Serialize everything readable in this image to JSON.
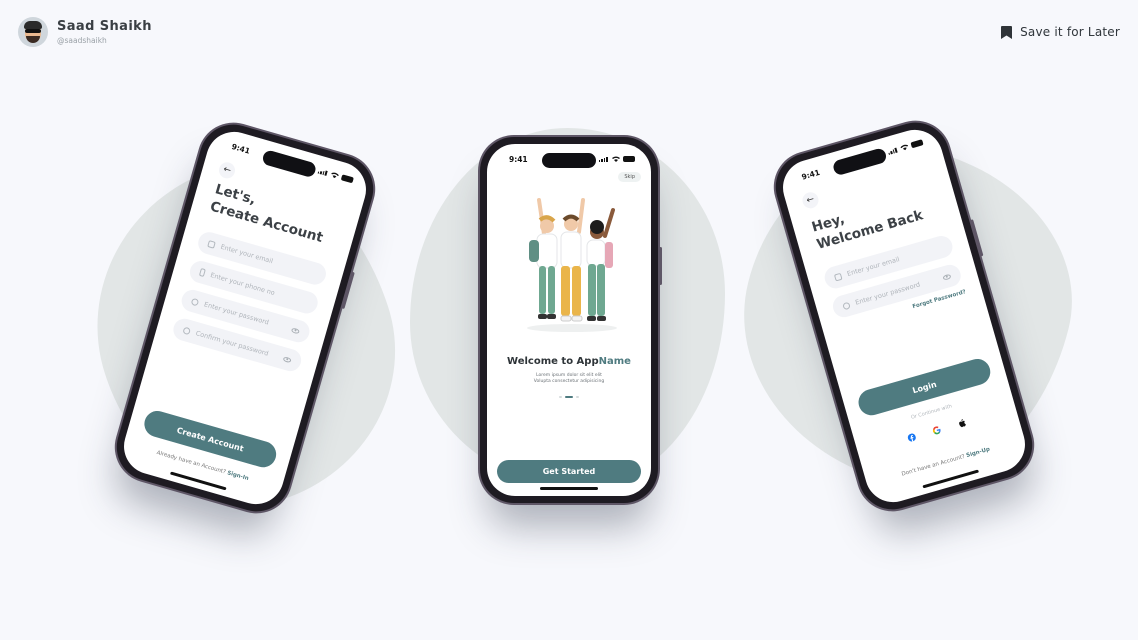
{
  "header": {
    "author_name": "Saad Shaikh",
    "author_handle": "@saadshaikh",
    "save_label": "Save it for Later"
  },
  "colors": {
    "accent": "#4f7b80",
    "background": "#f7f8fc",
    "blob": "#e2e6e6"
  },
  "signup": {
    "time": "9:41",
    "title_line1": "Let's,",
    "title_line2": "Create Account",
    "email_placeholder": "Enter your email",
    "phone_placeholder": "Enter your phone no",
    "password_placeholder": "Enter your password",
    "confirm_placeholder": "Confirm your password",
    "button_label": "Create Account",
    "footer_text": "Already have an Account?",
    "footer_link": "Sign-In"
  },
  "onboarding": {
    "time": "9:41",
    "skip_label": "Skip",
    "welcome_prefix": "Welcome to App",
    "welcome_accent": "Name",
    "description": "Lorem ipsum dolor sit elit elit Volupta consectetur adipisicing",
    "button_label": "Get Started",
    "page_index": 1,
    "page_count": 3
  },
  "login": {
    "time": "9:41",
    "title_line1": "Hey,",
    "title_line2": "Welcome Back",
    "email_placeholder": "Enter your email",
    "password_placeholder": "Enter your password",
    "forgot_label": "Forgot Password?",
    "button_label": "Login",
    "or_text": "Or Continue with",
    "socials": [
      "facebook-icon",
      "google-icon",
      "apple-icon"
    ],
    "footer_text": "Don't have an Account?",
    "footer_link": "Sign-Up"
  }
}
